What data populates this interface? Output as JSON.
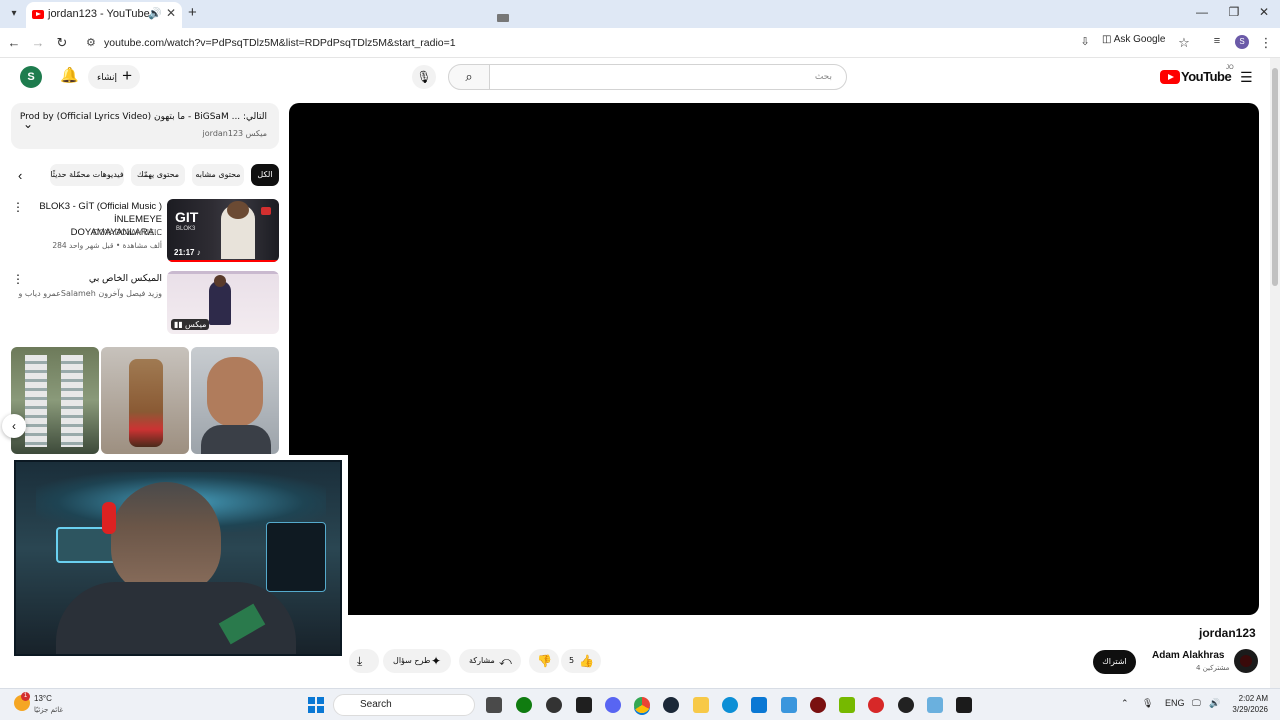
{
  "browser": {
    "tab_title": "jordan123 - YouTube",
    "url": "youtube.com/watch?v=PdPsqTDlz5M&list=RDPdPsqTDlz5M&start_radio=1",
    "ask_google": "Ask Google",
    "profile_initial": "S"
  },
  "header": {
    "avatar_initial": "S",
    "create_label": "إنشاء",
    "search_placeholder": "بحث",
    "logo_text": "YouTube",
    "logo_region": "JO"
  },
  "playlist": {
    "title": "التالي: ... BiGSaM - ما بتهون (Official Lyrics Video) Prod by",
    "subtitle": "ميكس jordan123"
  },
  "chips": [
    "الكل",
    "محتوى مشابه",
    "محتوى يهمّك",
    "فيديوهات محمّلة حديثًا"
  ],
  "recommended": [
    {
      "title": "BLOK3 - GİT (Official Music ) İNLEMEYE DOYAMAYANLARA...",
      "channel": "DOYADOYAMUSIC",
      "meta": "284 ألف مشاهدة • قبل شهر واحد",
      "duration": "21:17",
      "thumb_text": "GIT",
      "thumb_sub": "BLOK3"
    },
    {
      "title": "الميكس الخاص بي",
      "channel": "عمرو دياب وSalameh وزيد فيصل وآخرون",
      "meta": "",
      "duration": "ميكس"
    }
  ],
  "video": {
    "title": "jordan123",
    "channel_name": "Adam Alakhras",
    "subscribers": "4 مشتركين",
    "subscribe_label": "اشتراك",
    "likes": "5",
    "share_label": "مشاركة",
    "ask_label": "طرح سؤال"
  },
  "taskbar": {
    "temperature": "13°C",
    "condition": "غائم جزئيًا",
    "weather_badge": "1",
    "search_label": "Search",
    "language": "ENG",
    "time": "2:02 AM",
    "date": "3/29/2026"
  },
  "colors": {
    "youtube_red": "#ff0000",
    "player_bg": "#000000",
    "chip_active": "#0f0f0f",
    "taskbar_bg": "#eef1f6"
  }
}
